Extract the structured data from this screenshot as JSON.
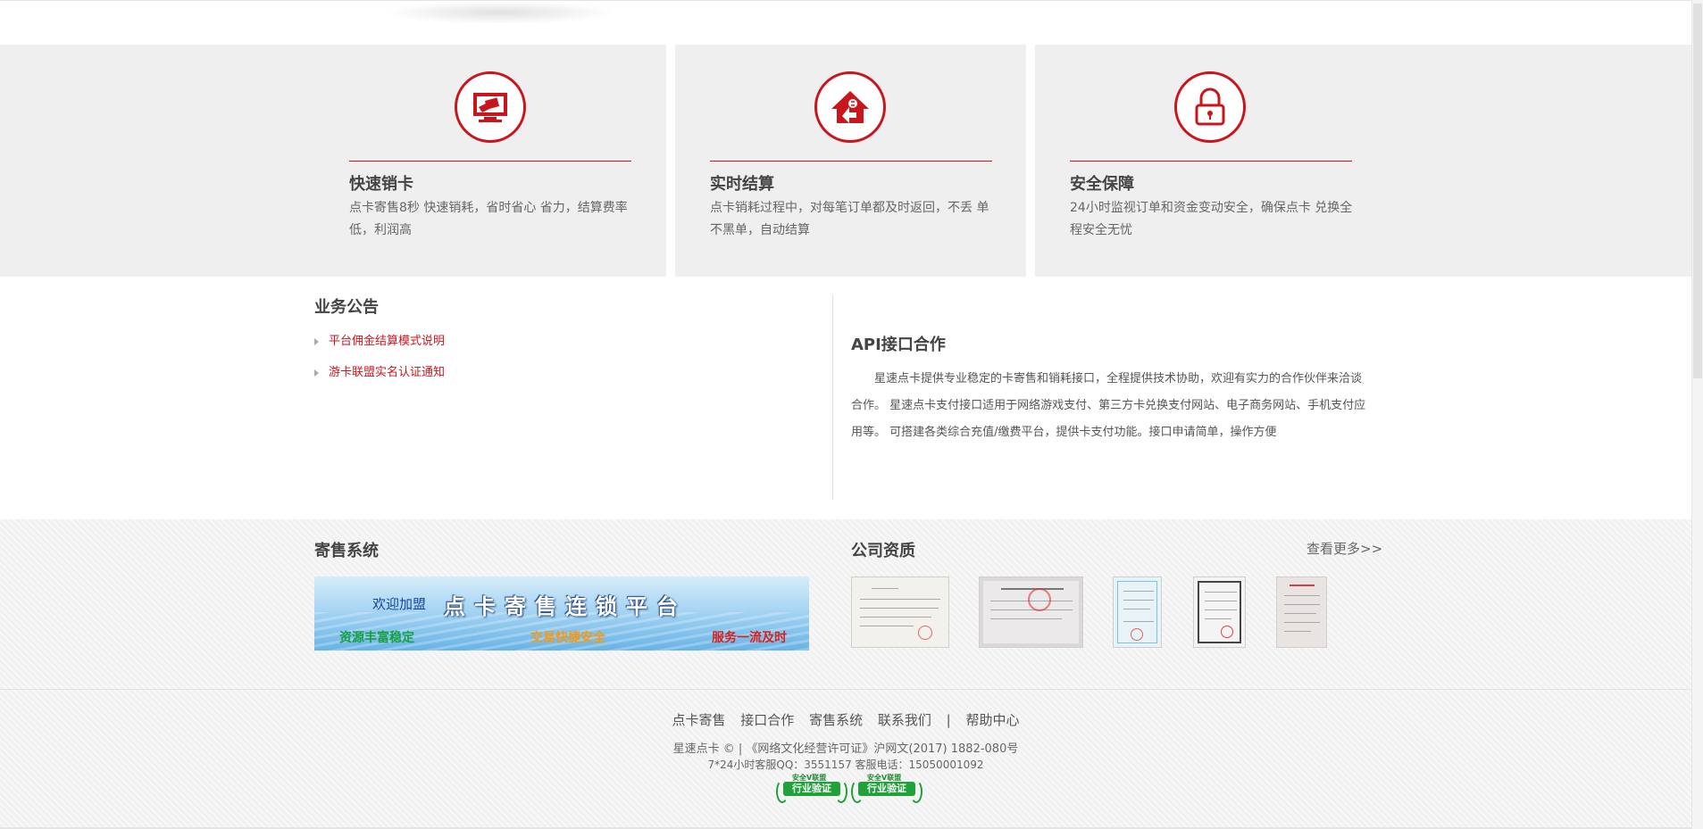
{
  "features": [
    {
      "title": "快速销卡",
      "desc": "点卡寄售8秒 快速销耗，省时省心 省力，结算费率低，利润高",
      "icon": "computer-card-icon"
    },
    {
      "title": "实时结算",
      "desc": "点卡销耗过程中，对每笔订单都及时返回，不丢 单不黑单，自动结算",
      "icon": "house-exchange-icon"
    },
    {
      "title": "安全保障",
      "desc": "24小时监视订单和资金变动安全，确保点卡 兑换全程安全无忧",
      "icon": "lock-icon"
    }
  ],
  "notice": {
    "title": "业务公告",
    "items": [
      "平台佣金结算模式说明",
      "游卡联盟实名认证通知"
    ]
  },
  "api": {
    "title": "API接口合作",
    "text": "星速点卡提供专业稳定的卡寄售和销耗接口，全程提供技术协助，欢迎有实力的合作伙伴来洽谈合作。 星速点卡支付接口适用于网络游戏支付、第三方卡兑换支付网站、电子商务网站、手机支付应用等。 可搭建各类综合充值/缴费平台，提供卡支付功能。接口申请简单，操作方便"
  },
  "consign": {
    "title": "寄售系统",
    "banner": {
      "small": "欢迎加盟",
      "big": "点卡寄售连锁平台",
      "s1": "资源丰富稳定",
      "s2": "交易快捷安全",
      "s3": "服务一流及时"
    }
  },
  "certs": {
    "title": "公司资质",
    "more": "查看更多>>"
  },
  "footer": {
    "nav": [
      "点卡寄售",
      "接口合作",
      "寄售系统",
      "联系我们",
      "|",
      "帮助中心"
    ],
    "copy": "星速点卡 ©  |  《网络文化经营许可证》沪网文(2017) 1882-080号",
    "service": "7*24小时客服QQ：3551157 客服电话：15050001092",
    "badge_top": "安全V联盟",
    "badge_main": "行业验证"
  },
  "colors": {
    "accent": "#c9161d",
    "panel": "#efefef"
  }
}
